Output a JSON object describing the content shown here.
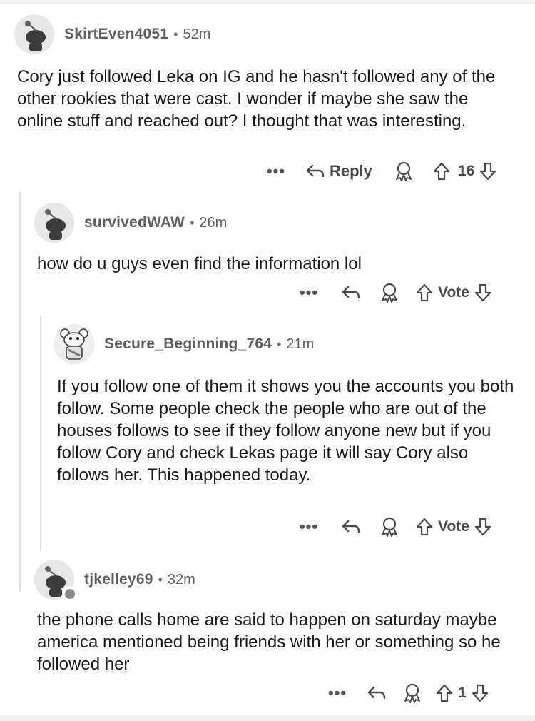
{
  "comments": [
    {
      "username": "SkirtEven4051",
      "time": "52m",
      "separator": "•",
      "text": "Cory just followed Leka on IG and he hasn't followed any of the other rookies that were cast. I wonder if maybe she saw the online stuff and reached out? I thought that was interesting.",
      "actions": {
        "more": "•••",
        "reply": "Reply",
        "score": "16"
      }
    },
    {
      "username": "survivedWAW",
      "time": "26m",
      "separator": "•",
      "text": "how do u guys even find the information lol",
      "actions": {
        "more": "•••",
        "score": "Vote"
      }
    },
    {
      "username": "Secure_Beginning_764",
      "time": "21m",
      "separator": "•",
      "text": "If you follow one of them it shows you the accounts you both follow. Some people check the people who are out of the houses follows to see if they follow anyone new but if you follow Cory and check Lekas page it will say Cory also follows her. This happened today.",
      "actions": {
        "more": "•••",
        "score": "Vote"
      }
    },
    {
      "username": "tjkelley69",
      "time": "32m",
      "separator": "•",
      "text": "the phone calls home are said to happen on saturday maybe america mentioned being friends with her or something so he followed her",
      "actions": {
        "more": "•••",
        "score": "1"
      }
    }
  ],
  "icons": {
    "avatar": "snoo-avatar-icon",
    "reply": "reply-arrow-icon",
    "award": "award-icon",
    "upvote": "upvote-arrow-icon",
    "downvote": "downvote-arrow-icon"
  },
  "colors": {
    "text": "#1a1a1a",
    "meta": "#5f5f5f",
    "thread_line": "#e3e3e3"
  }
}
